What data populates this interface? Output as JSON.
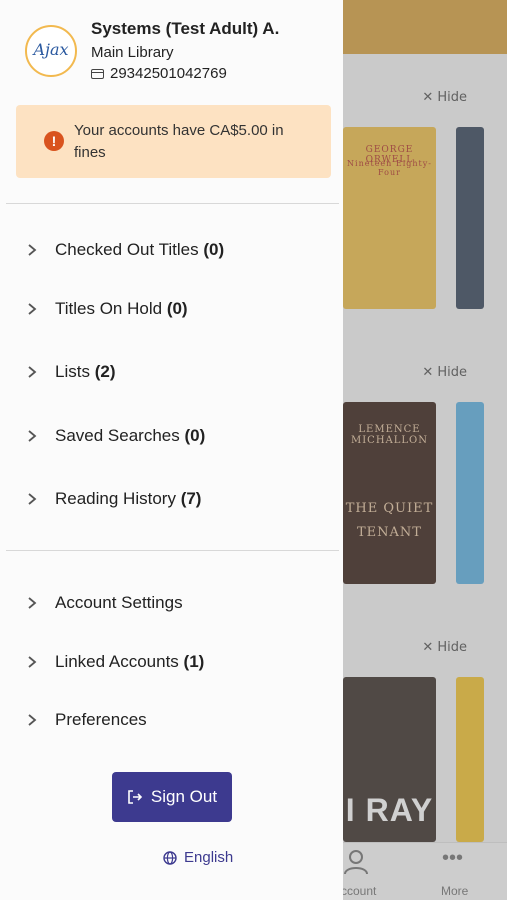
{
  "background": {
    "hide_label": "Hide",
    "covers": {
      "c1_author": "GEORGE ORWELL",
      "c1_title": "Nineteen Eighty-Four",
      "c2_author": "LEMENCE MICHALLON",
      "c2_title": "THE QUIET TENANT",
      "c3_title": "I RAY"
    },
    "nav": {
      "account_label": "ccount",
      "more_label": "More"
    }
  },
  "drawer": {
    "logo_text": "Ajax",
    "user_name": "Systems (Test Adult) A.",
    "library": "Main Library",
    "card_number": "29342501042769",
    "fine_message": "Your accounts have CA$5.00 in fines",
    "menu_primary": [
      {
        "label": "Checked Out Titles",
        "count": "(0)"
      },
      {
        "label": "Titles On Hold",
        "count": "(0)"
      },
      {
        "label": "Lists",
        "count": "(2)"
      },
      {
        "label": "Saved Searches",
        "count": "(0)"
      },
      {
        "label": "Reading History",
        "count": "(7)"
      }
    ],
    "menu_secondary": [
      {
        "label": "Account Settings",
        "count": ""
      },
      {
        "label": "Linked Accounts",
        "count": "(1)"
      },
      {
        "label": "Preferences",
        "count": ""
      }
    ],
    "sign_out_label": "Sign Out",
    "language": "English"
  },
  "colors": {
    "header_accent": "#d9a441",
    "primary_button": "#3d3a8f",
    "fine_background": "#fde2c2",
    "fine_icon": "#d9531e"
  },
  "icons": [
    "card-icon",
    "alert-icon",
    "chevron-right-icon",
    "sign-out-icon",
    "moon-icon",
    "globe-icon",
    "account-icon",
    "more-icon",
    "close-icon"
  ]
}
